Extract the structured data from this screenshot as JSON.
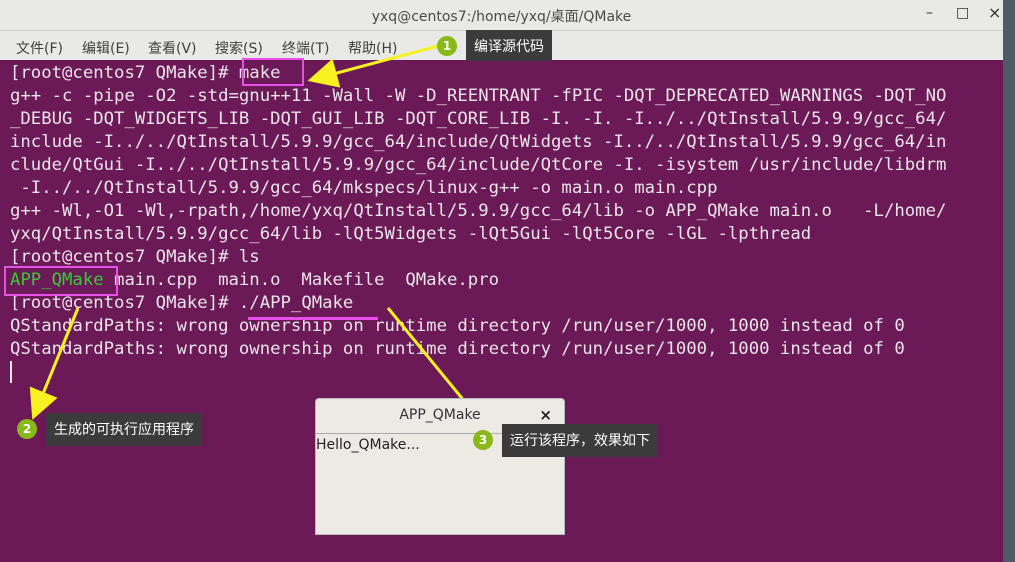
{
  "window": {
    "title": "yxq@centos7:/home/yxq/桌面/QMake",
    "minimize": "–",
    "maximize": "□",
    "close": "×"
  },
  "menubar": {
    "items": [
      "文件(F)",
      "编辑(E)",
      "查看(V)",
      "搜索(S)",
      "终端(T)",
      "帮助(H)"
    ]
  },
  "terminal": {
    "lines": [
      "[root@centos7 QMake]# make",
      "g++ -c -pipe -O2 -std=gnu++11 -Wall -W -D_REENTRANT -fPIC -DQT_DEPRECATED_WARNINGS -DQT_NO",
      "_DEBUG -DQT_WIDGETS_LIB -DQT_GUI_LIB -DQT_CORE_LIB -I. -I. -I../../QtInstall/5.9.9/gcc_64/",
      "include -I../../QtInstall/5.9.9/gcc_64/include/QtWidgets -I../../QtInstall/5.9.9/gcc_64/in",
      "clude/QtGui -I../../QtInstall/5.9.9/gcc_64/include/QtCore -I. -isystem /usr/include/libdrm",
      " -I../../QtInstall/5.9.9/gcc_64/mkspecs/linux-g++ -o main.o main.cpp",
      "g++ -Wl,-O1 -Wl,-rpath,/home/yxq/QtInstall/5.9.9/gcc_64/lib -o APP_QMake main.o   -L/home/",
      "yxq/QtInstall/5.9.9/gcc_64/lib -lQt5Widgets -lQt5Gui -lQt5Core -lGL -lpthread",
      "[root@centos7 QMake]# ls",
      "",
      "[root@centos7 QMake]# ./APP_QMake",
      "QStandardPaths: wrong ownership on runtime directory /run/user/1000, 1000 instead of 0",
      "QStandardPaths: wrong ownership on runtime directory /run/user/1000, 1000 instead of 0"
    ],
    "ls_exec": "APP_QMake",
    "ls_rest": " main.cpp  main.o  Makefile  QMake.pro"
  },
  "callouts": [
    {
      "num": "1",
      "text": "编译源代码"
    },
    {
      "num": "2",
      "text": "生成的可执行应用程序"
    },
    {
      "num": "3",
      "text": "运行该程序，效果如下"
    }
  ],
  "dialog": {
    "title": "APP_QMake",
    "close": "×",
    "label": "Hello_QMake..."
  },
  "colors": {
    "terminal_bg": "#6c1a57",
    "highlight": "#e84ee8",
    "arrow": "#f7f122",
    "badge": "#88b919",
    "executable": "#39c83a"
  }
}
